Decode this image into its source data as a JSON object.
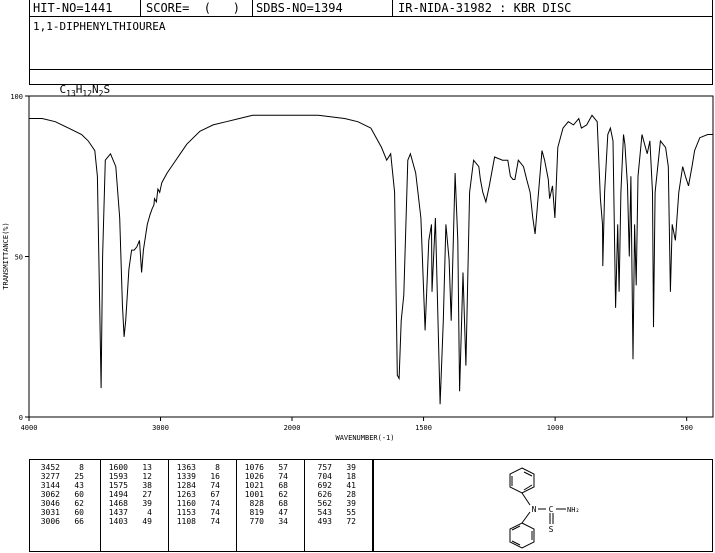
{
  "header": {
    "hit_no": "HIT-NO=1441",
    "score": "SCORE=  (   )",
    "sdbs_no": "SDBS-NO=1394",
    "ir_info": "IR-NIDA-31982 : KBR DISC"
  },
  "compound_name": "1,1-DIPHENYLTHIOUREA",
  "formula": {
    "parts": [
      "C",
      "13",
      "H",
      "12",
      "N",
      "2",
      "S"
    ]
  },
  "chart_data": {
    "type": "line",
    "title": "",
    "xlabel": "WAVENUMBER(-1)",
    "ylabel": "TRANSMITTANCE(%)",
    "xlim": [
      4000,
      400
    ],
    "ylim": [
      0,
      100
    ],
    "x_ticks": [
      4000,
      3000,
      2000,
      1500,
      1000,
      500
    ],
    "y_ticks": [
      0,
      50,
      100
    ],
    "grid": false,
    "series": [
      {
        "points": [
          [
            4000,
            93
          ],
          [
            3900,
            93
          ],
          [
            3800,
            92
          ],
          [
            3700,
            90
          ],
          [
            3600,
            88
          ],
          [
            3550,
            86
          ],
          [
            3500,
            83
          ],
          [
            3480,
            75
          ],
          [
            3465,
            40
          ],
          [
            3452,
            9
          ],
          [
            3440,
            50
          ],
          [
            3420,
            80
          ],
          [
            3380,
            82
          ],
          [
            3340,
            78
          ],
          [
            3310,
            62
          ],
          [
            3290,
            35
          ],
          [
            3277,
            25
          ],
          [
            3265,
            30
          ],
          [
            3240,
            46
          ],
          [
            3220,
            52
          ],
          [
            3200,
            52
          ],
          [
            3180,
            53
          ],
          [
            3160,
            55
          ],
          [
            3144,
            45
          ],
          [
            3130,
            52
          ],
          [
            3100,
            60
          ],
          [
            3080,
            63
          ],
          [
            3062,
            65
          ],
          [
            3050,
            66
          ],
          [
            3046,
            68
          ],
          [
            3031,
            67
          ],
          [
            3020,
            71
          ],
          [
            3006,
            70
          ],
          [
            2990,
            73
          ],
          [
            2950,
            76
          ],
          [
            2900,
            79
          ],
          [
            2850,
            82
          ],
          [
            2800,
            85
          ],
          [
            2700,
            89
          ],
          [
            2600,
            91
          ],
          [
            2500,
            92
          ],
          [
            2400,
            93
          ],
          [
            2300,
            94
          ],
          [
            2200,
            94
          ],
          [
            2100,
            94
          ],
          [
            2000,
            94
          ],
          [
            1900,
            94
          ],
          [
            1800,
            93
          ],
          [
            1750,
            92
          ],
          [
            1700,
            90
          ],
          [
            1660,
            84
          ],
          [
            1640,
            80
          ],
          [
            1625,
            82
          ],
          [
            1610,
            70
          ],
          [
            1600,
            13
          ],
          [
            1593,
            12
          ],
          [
            1585,
            30
          ],
          [
            1575,
            38
          ],
          [
            1560,
            80
          ],
          [
            1550,
            82
          ],
          [
            1530,
            76
          ],
          [
            1510,
            62
          ],
          [
            1494,
            27
          ],
          [
            1480,
            55
          ],
          [
            1470,
            60
          ],
          [
            1468,
            39
          ],
          [
            1455,
            62
          ],
          [
            1437,
            4
          ],
          [
            1425,
            30
          ],
          [
            1415,
            60
          ],
          [
            1403,
            49
          ],
          [
            1395,
            30
          ],
          [
            1380,
            76
          ],
          [
            1370,
            55
          ],
          [
            1363,
            8
          ],
          [
            1350,
            45
          ],
          [
            1339,
            16
          ],
          [
            1325,
            70
          ],
          [
            1310,
            80
          ],
          [
            1290,
            78
          ],
          [
            1284,
            74
          ],
          [
            1275,
            70
          ],
          [
            1263,
            67
          ],
          [
            1250,
            72
          ],
          [
            1230,
            81
          ],
          [
            1200,
            80
          ],
          [
            1180,
            80
          ],
          [
            1170,
            75
          ],
          [
            1160,
            74
          ],
          [
            1153,
            74
          ],
          [
            1140,
            80
          ],
          [
            1120,
            78
          ],
          [
            1108,
            74
          ],
          [
            1095,
            70
          ],
          [
            1085,
            62
          ],
          [
            1076,
            57
          ],
          [
            1065,
            68
          ],
          [
            1050,
            83
          ],
          [
            1040,
            80
          ],
          [
            1026,
            74
          ],
          [
            1021,
            68
          ],
          [
            1010,
            72
          ],
          [
            1001,
            62
          ],
          [
            990,
            84
          ],
          [
            970,
            90
          ],
          [
            950,
            92
          ],
          [
            930,
            91
          ],
          [
            910,
            93
          ],
          [
            900,
            90
          ],
          [
            880,
            91
          ],
          [
            860,
            94
          ],
          [
            840,
            92
          ],
          [
            828,
            68
          ],
          [
            820,
            60
          ],
          [
            819,
            47
          ],
          [
            812,
            70
          ],
          [
            800,
            88
          ],
          [
            790,
            90
          ],
          [
            780,
            86
          ],
          [
            770,
            34
          ],
          [
            762,
            60
          ],
          [
            757,
            39
          ],
          [
            750,
            70
          ],
          [
            740,
            88
          ],
          [
            735,
            85
          ],
          [
            725,
            72
          ],
          [
            718,
            50
          ],
          [
            712,
            75
          ],
          [
            704,
            18
          ],
          [
            698,
            60
          ],
          [
            692,
            41
          ],
          [
            685,
            75
          ],
          [
            670,
            88
          ],
          [
            660,
            85
          ],
          [
            650,
            82
          ],
          [
            640,
            86
          ],
          [
            630,
            70
          ],
          [
            626,
            28
          ],
          [
            620,
            70
          ],
          [
            600,
            86
          ],
          [
            580,
            84
          ],
          [
            570,
            78
          ],
          [
            562,
            39
          ],
          [
            555,
            60
          ],
          [
            543,
            55
          ],
          [
            530,
            70
          ],
          [
            515,
            78
          ],
          [
            505,
            75
          ],
          [
            493,
            72
          ],
          [
            480,
            78
          ],
          [
            470,
            83
          ],
          [
            450,
            87
          ],
          [
            420,
            88
          ],
          [
            400,
            88
          ]
        ]
      }
    ]
  },
  "peak_table": {
    "columns": [
      [
        [
          "3452",
          "8"
        ],
        [
          "3277",
          "25"
        ],
        [
          "3144",
          "43"
        ],
        [
          "3062",
          "60"
        ],
        [
          "3046",
          "62"
        ],
        [
          "3031",
          "60"
        ],
        [
          "3006",
          "66"
        ]
      ],
      [
        [
          "1600",
          "13"
        ],
        [
          "1593",
          "12"
        ],
        [
          "1575",
          "38"
        ],
        [
          "1494",
          "27"
        ],
        [
          "1468",
          "39"
        ],
        [
          "1437",
          "4"
        ],
        [
          "1403",
          "49"
        ]
      ],
      [
        [
          "1363",
          "8"
        ],
        [
          "1339",
          "16"
        ],
        [
          "1284",
          "74"
        ],
        [
          "1263",
          "67"
        ],
        [
          "1160",
          "74"
        ],
        [
          "1153",
          "74"
        ],
        [
          "1108",
          "74"
        ]
      ],
      [
        [
          "1076",
          "57"
        ],
        [
          "1026",
          "74"
        ],
        [
          "1021",
          "68"
        ],
        [
          "1001",
          "62"
        ],
        [
          "828",
          "68"
        ],
        [
          "819",
          "47"
        ],
        [
          "770",
          "34"
        ]
      ],
      [
        [
          "757",
          "39"
        ],
        [
          "704",
          "18"
        ],
        [
          "692",
          "41"
        ],
        [
          "626",
          "28"
        ],
        [
          "562",
          "39"
        ],
        [
          "543",
          "55"
        ],
        [
          "493",
          "72"
        ]
      ]
    ]
  },
  "structure": {
    "label_n": "N",
    "label_c": "C",
    "label_nh2": "NH₂",
    "label_s": "S"
  }
}
